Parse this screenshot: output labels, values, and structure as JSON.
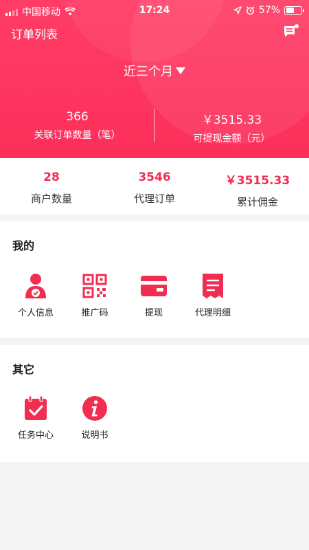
{
  "status_bar": {
    "carrier": "中国移动",
    "time": "17:24",
    "battery_pct": "57%",
    "battery_level": 0.57
  },
  "header": {
    "title": "订单列表",
    "message_icon": "message-icon",
    "period_label": "近三个月"
  },
  "header_stats": {
    "left": {
      "value": "366",
      "label": "关联订单数量（笔）"
    },
    "right": {
      "value": "￥3515.33",
      "label": "可提现金额（元）"
    }
  },
  "summary": [
    {
      "value": "28",
      "label": "商户数量"
    },
    {
      "value": "3546",
      "label": "代理订单"
    },
    {
      "value": "￥3515.33",
      "label": "累计佣金"
    }
  ],
  "mine": {
    "title": "我的",
    "items": [
      {
        "label": "个人信息",
        "icon": "user-icon"
      },
      {
        "label": "推广码",
        "icon": "qr-code-icon"
      },
      {
        "label": "提现",
        "icon": "card-icon"
      },
      {
        "label": "代理明细",
        "icon": "receipt-icon"
      }
    ]
  },
  "other": {
    "title": "其它",
    "items": [
      {
        "label": "任务中心",
        "icon": "calendar-check-icon"
      },
      {
        "label": "说明书",
        "icon": "info-icon"
      }
    ]
  },
  "colors": {
    "accent": "#f12d52",
    "header_bg": "#fb2f5a"
  }
}
